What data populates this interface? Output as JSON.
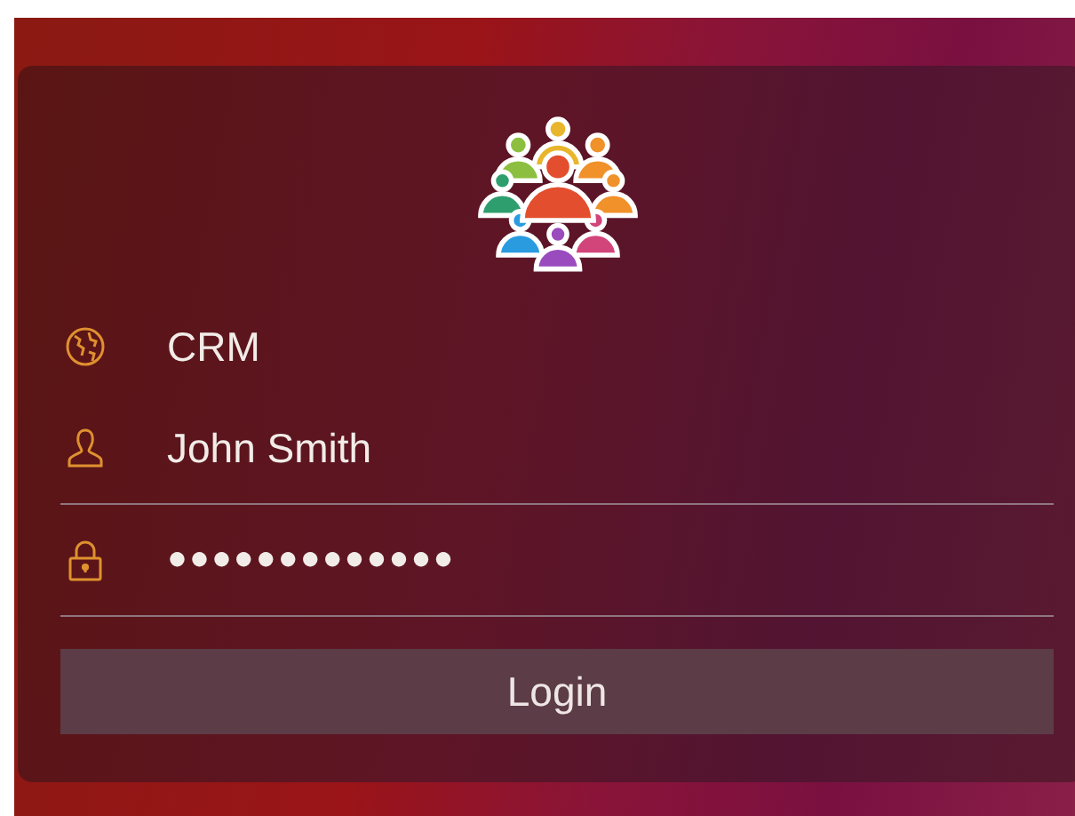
{
  "login_form": {
    "fields": [
      {
        "kind": "server",
        "value": "CRM"
      },
      {
        "kind": "user",
        "value": "John Smith"
      },
      {
        "kind": "password",
        "value": "●●●●●●●●●●●●●"
      }
    ],
    "button": "Login"
  }
}
